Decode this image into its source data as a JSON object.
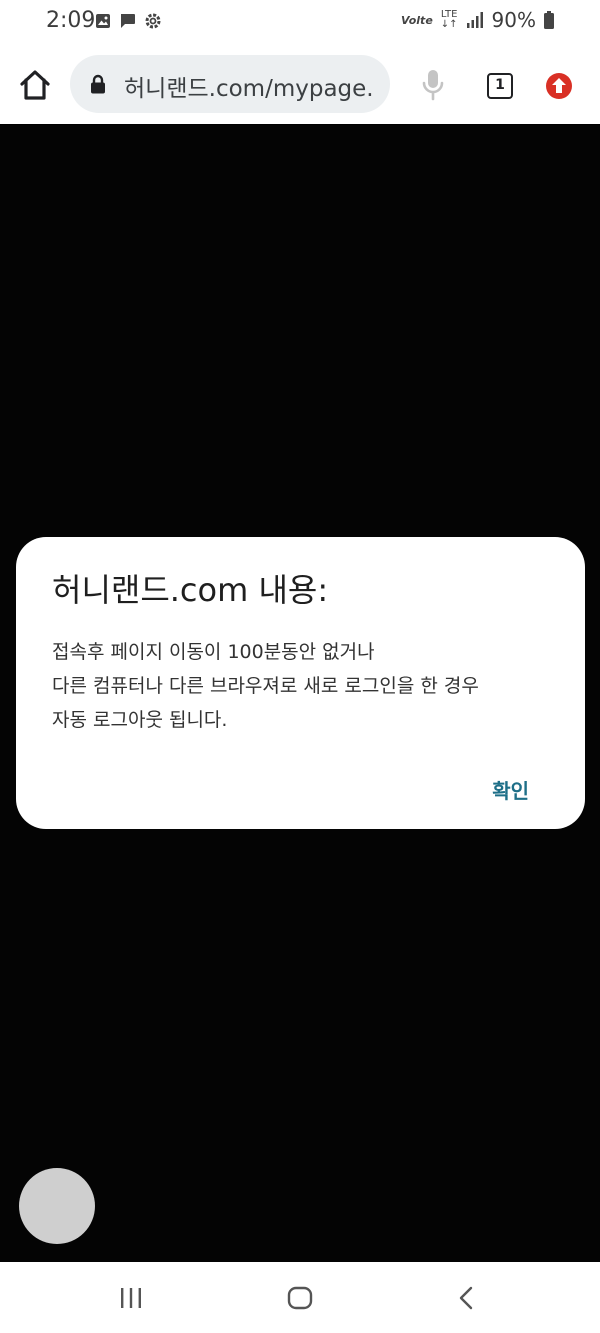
{
  "status_bar": {
    "time": "2:09",
    "network_label": "LTE",
    "volte_label": "Volte",
    "battery": "90%"
  },
  "toolbar": {
    "url": "허니랜드.com/mypage.",
    "tab_count": "1",
    "load_progress": 0.2
  },
  "dialog": {
    "title": "허니랜드.com 내용:",
    "message": "접속후 페이지 이동이 100분동안 없거나\n다른 컴퓨터나 다른 브라우져로 새로 로그인을 한 경우\n자동 로그아웃 됩니다.",
    "ok_label": "확인"
  },
  "colors": {
    "accent": "#1e6f88",
    "update_icon": "#d93025",
    "backdrop": "#040404"
  },
  "icons": {
    "status_left": [
      "image-icon",
      "chat-icon",
      "settings-icon"
    ],
    "toolbar": [
      "home-icon",
      "lock-icon",
      "mic-icon",
      "tab-switcher-icon",
      "update-icon"
    ],
    "nav": [
      "recents-icon",
      "home-nav-icon",
      "back-icon"
    ]
  }
}
